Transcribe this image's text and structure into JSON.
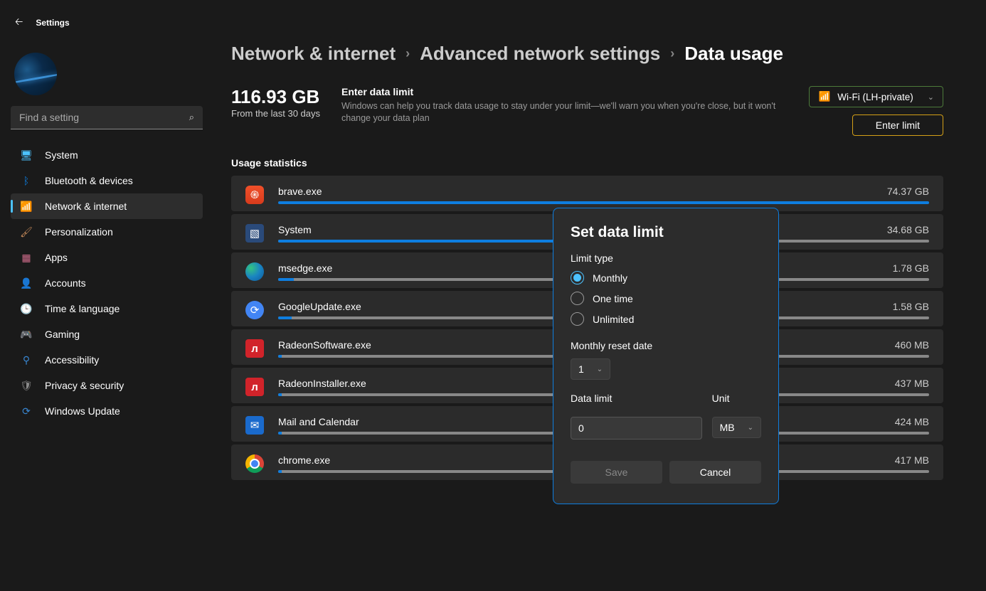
{
  "app_title": "Settings",
  "search_placeholder": "Find a setting",
  "nav": [
    {
      "label": "System",
      "icon": "ic-sys",
      "glyph": "🖥"
    },
    {
      "label": "Bluetooth & devices",
      "icon": "ic-bt",
      "glyph": "ᛒ"
    },
    {
      "label": "Network & internet",
      "icon": "ic-net",
      "glyph": "📶",
      "active": true
    },
    {
      "label": "Personalization",
      "icon": "ic-pers",
      "glyph": "🖌"
    },
    {
      "label": "Apps",
      "icon": "ic-apps",
      "glyph": "▦"
    },
    {
      "label": "Accounts",
      "icon": "ic-acct",
      "glyph": "👤"
    },
    {
      "label": "Time & language",
      "icon": "ic-time",
      "glyph": "🕒"
    },
    {
      "label": "Gaming",
      "icon": "ic-game",
      "glyph": "🎮"
    },
    {
      "label": "Accessibility",
      "icon": "ic-acc",
      "glyph": "⚲"
    },
    {
      "label": "Privacy & security",
      "icon": "ic-priv",
      "glyph": "🛡"
    },
    {
      "label": "Windows Update",
      "icon": "ic-wu",
      "glyph": "⟳"
    }
  ],
  "breadcrumbs": [
    "Network & internet",
    "Advanced network settings",
    "Data usage"
  ],
  "total": {
    "value": "116.93 GB",
    "sub": "From the last 30 days"
  },
  "limit_block": {
    "title": "Enter data limit",
    "desc": "Windows can help you track data usage to stay under your limit—we'll warn you when you're close, but it won't change your data plan"
  },
  "network_dropdown": {
    "label": "Wi-Fi (LH-private)"
  },
  "enter_limit_btn": "Enter limit",
  "stats_title": "Usage statistics",
  "stats": [
    {
      "name": "brave.exe",
      "value": "74.37 GB",
      "pct": 100,
      "cls": "brave",
      "glyph": "֍"
    },
    {
      "name": "System",
      "value": "34.68 GB",
      "pct": 47,
      "cls": "sysapp",
      "glyph": "▧"
    },
    {
      "name": "msedge.exe",
      "value": "1.78 GB",
      "pct": 2.4,
      "cls": "edge",
      "glyph": ""
    },
    {
      "name": "GoogleUpdate.exe",
      "value": "1.58 GB",
      "pct": 2.1,
      "cls": "gupd",
      "glyph": "⟳"
    },
    {
      "name": "RadeonSoftware.exe",
      "value": "460 MB",
      "pct": 0.6,
      "cls": "radeon",
      "glyph": "л"
    },
    {
      "name": "RadeonInstaller.exe",
      "value": "437 MB",
      "pct": 0.6,
      "cls": "radeon",
      "glyph": "л"
    },
    {
      "name": "Mail and Calendar",
      "value": "424 MB",
      "pct": 0.56,
      "cls": "mail",
      "glyph": "✉"
    },
    {
      "name": "chrome.exe",
      "value": "417 MB",
      "pct": 0.55,
      "cls": "chrome",
      "glyph": ""
    }
  ],
  "dialog": {
    "title": "Set data limit",
    "limit_type_lbl": "Limit type",
    "radios": [
      "Monthly",
      "One time",
      "Unlimited"
    ],
    "selected": 0,
    "reset_lbl": "Monthly reset date",
    "reset_value": "1",
    "data_limit_lbl": "Data limit",
    "data_limit_value": "0",
    "unit_lbl": "Unit",
    "unit_value": "MB",
    "save": "Save",
    "cancel": "Cancel"
  }
}
